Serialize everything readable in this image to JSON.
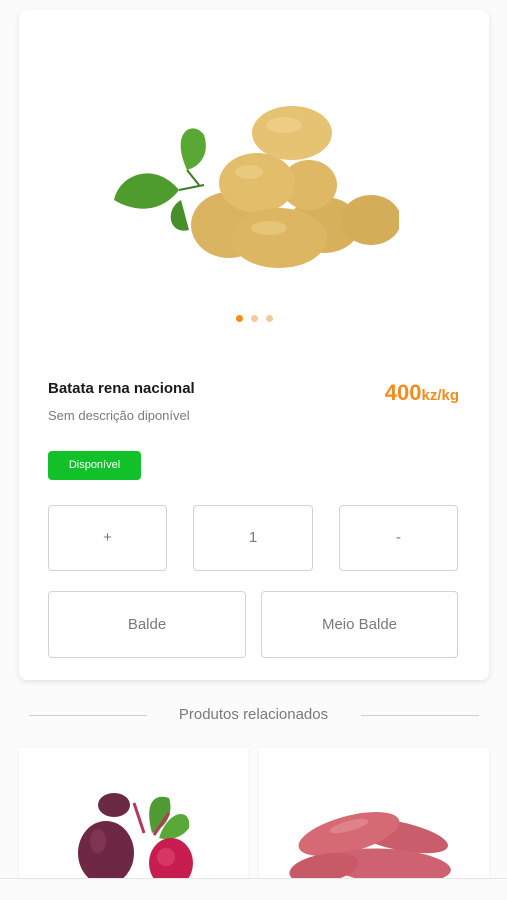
{
  "product": {
    "name": "Batata rena nacional",
    "description": "Sem descrição diponível",
    "price_amount": "400",
    "price_unit": "kz/kg",
    "availability": "Disponível",
    "carousel": {
      "total": 3,
      "active": 1
    },
    "image_icon": "potatoes-image"
  },
  "quantity": {
    "increase_label": "+",
    "value": "1",
    "decrease_label": "-"
  },
  "options": {
    "balde_label": "Balde",
    "meio_balde_label": "Meio Balde"
  },
  "related": {
    "title": "Produtos relacionados",
    "items": [
      {
        "icon": "beetroot-image"
      },
      {
        "icon": "sweet-potato-image"
      }
    ]
  },
  "colors": {
    "accent": "#f28c1f",
    "available": "#12c02a"
  }
}
